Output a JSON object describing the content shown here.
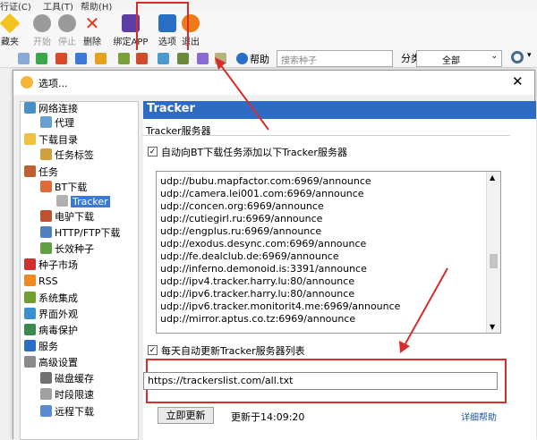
{
  "menu": {
    "items": [
      "行证(C)",
      "工具(T)",
      "帮助(H)"
    ]
  },
  "toolbar": {
    "buttons": [
      {
        "label": "藏夹",
        "icon": "star-icon",
        "color": "#f3c31f"
      },
      {
        "label": "开始",
        "icon": "play-icon",
        "color": "#9a9a9a"
      },
      {
        "label": "停止",
        "icon": "stop-icon",
        "color": "#9a9a9a"
      },
      {
        "label": "删除",
        "icon": "delete-icon",
        "color": "#e03b1d"
      },
      {
        "label": "绑定APP",
        "icon": "phone-icon",
        "color": "#5a3ea5"
      },
      {
        "label": "选项",
        "icon": "options-icon",
        "color": "#2a6fc6"
      },
      {
        "label": "退出",
        "icon": "power-icon",
        "color": "#f07a14"
      }
    ],
    "help_label": "帮助",
    "search_placeholder": "搜索种子",
    "category_label": "分类",
    "category_value": "全部"
  },
  "dialog": {
    "title": "选项...",
    "tree": [
      {
        "label": "网络连接",
        "icon": "network-icon"
      },
      {
        "label": "代理",
        "icon": "proxy-icon"
      },
      {
        "label": "下载目录",
        "icon": "folder-icon"
      },
      {
        "label": "任务标签",
        "icon": "tag-icon"
      },
      {
        "label": "任务",
        "icon": "task-icon"
      },
      {
        "label": "BT下载",
        "icon": "bt-icon"
      },
      {
        "label": "Tracker",
        "icon": "tracker-icon"
      },
      {
        "label": "电驴下载",
        "icon": "emule-icon"
      },
      {
        "label": "HTTP/FTP下载",
        "icon": "http-icon"
      },
      {
        "label": "长效种子",
        "icon": "seed-icon"
      },
      {
        "label": "种子市场",
        "icon": "magnet-icon"
      },
      {
        "label": "RSS",
        "icon": "rss-icon"
      },
      {
        "label": "系统集成",
        "icon": "integration-icon"
      },
      {
        "label": "界面外观",
        "icon": "appearance-icon"
      },
      {
        "label": "病毒保护",
        "icon": "virus-icon"
      },
      {
        "label": "服务",
        "icon": "service-icon"
      },
      {
        "label": "高级设置",
        "icon": "advanced-icon"
      },
      {
        "label": "磁盘缓存",
        "icon": "disk-icon"
      },
      {
        "label": "时段限速",
        "icon": "clock-icon"
      },
      {
        "label": "远程下载",
        "icon": "remote-icon"
      }
    ],
    "panel": {
      "header": "Tracker",
      "group_title": "Tracker服务器",
      "auto_add_label": "自动向BT下载任务添加以下Tracker服务器",
      "trackers": [
        "udp://bubu.mapfactor.com:6969/announce",
        "udp://camera.lei001.com:6969/announce",
        "udp://concen.org:6969/announce",
        "udp://cutiegirl.ru:6969/announce",
        "udp://engplus.ru:6969/announce",
        "udp://exodus.desync.com:6969/announce",
        "udp://fe.dealclub.de:6969/announce",
        "udp://inferno.demonoid.is:3391/announce",
        "udp://ipv4.tracker.harry.lu:80/announce",
        "udp://ipv6.tracker.harry.lu:80/announce",
        "udp://ipv6.tracker.monitorit4.me:6969/announce",
        "udp://mirror.aptus.co.tz:6969/announce"
      ],
      "daily_update_label": "每天自动更新Tracker服务器列表",
      "url_value": "https://trackerslist.com/all.txt",
      "update_now_label": "立即更新",
      "updated_at": "更新于14:09:20",
      "help_link": "详细帮助"
    }
  }
}
